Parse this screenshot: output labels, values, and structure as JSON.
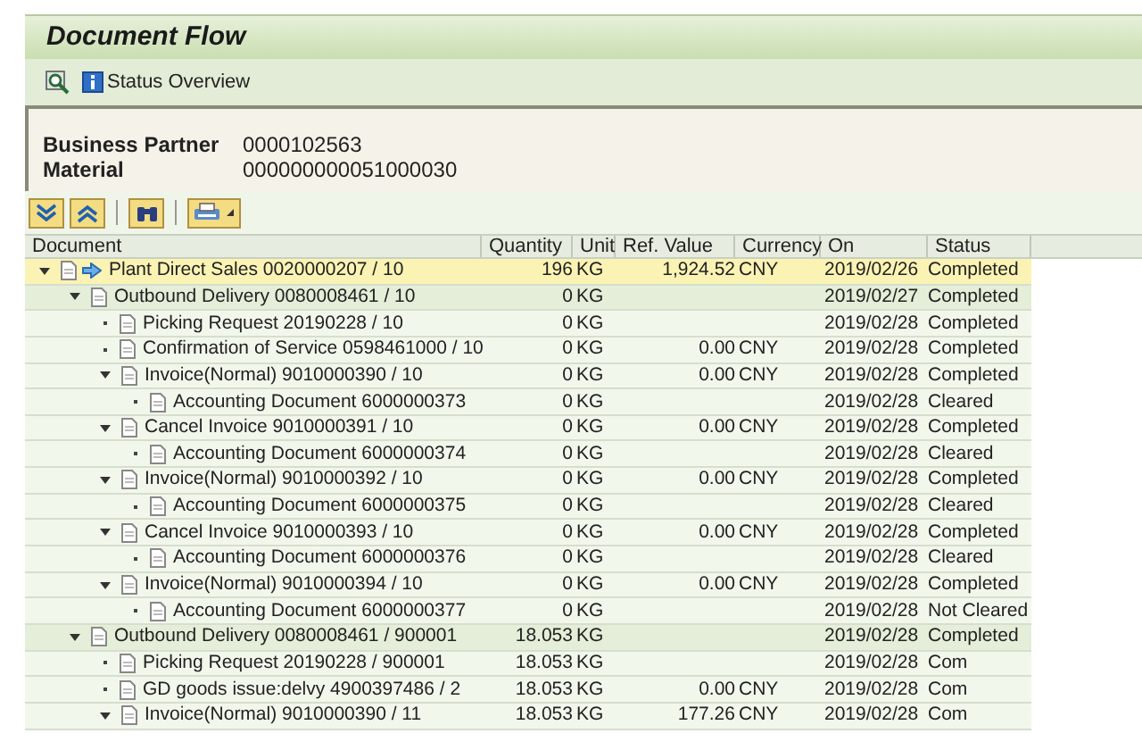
{
  "window": {
    "title": "Document Flow"
  },
  "toolbar": {
    "items": [
      {
        "kind": "icon"
      },
      {
        "kind": "info",
        "label": "Status Overview"
      }
    ]
  },
  "header": {
    "fields": [
      {
        "label": "Business Partner",
        "value": "0000102563"
      },
      {
        "label": "Material",
        "value": "000000000051000030"
      }
    ]
  },
  "table": {
    "columns": [
      "Document",
      "Quantity",
      "Unit",
      "Ref. Value",
      "Currency",
      "On",
      "Status"
    ],
    "rows": [
      {
        "document": "Plant Direct Sales 0020000207 / 10",
        "quantity": "196",
        "unit": "KG",
        "ref_value": "1,924.52",
        "currency": "CNY",
        "on": "2019/02/26",
        "status": "Completed",
        "expanded": true,
        "current": true,
        "children": [
          {
            "document": "Outbound Delivery 0080008461 / 10",
            "quantity": "0",
            "unit": "KG",
            "on": "2019/02/27",
            "status": "Completed",
            "expanded": true,
            "current": false,
            "children": [
              {
                "document": "Picking Request 20190228 / 10",
                "quantity": "0",
                "unit": "KG",
                "on": "2019/02/28",
                "status": "Completed",
                "expanded": false,
                "current": false
              },
              {
                "document": "Confirmation of Service 0598461000 / 10",
                "quantity": "0",
                "unit": "KG",
                "ref_value": "0.00",
                "currency": "CNY",
                "on": "2019/02/28",
                "status": "Completed",
                "expanded": false,
                "current": false
              },
              {
                "document": "Invoice(Normal) 9010000390 / 10",
                "quantity": "0",
                "unit": "KG",
                "ref_value": "0.00",
                "currency": "CNY",
                "on": "2019/02/28",
                "status": "Completed",
                "expanded": true,
                "current": false,
                "children": [
                  {
                    "document": "Accounting Document 6000000373",
                    "quantity": "0",
                    "unit": "KG",
                    "on": "2019/02/28",
                    "status": "Cleared",
                    "expanded": false,
                    "current": false
                  }
                ]
              },
              {
                "document": "Cancel Invoice 9010000391 / 10",
                "quantity": "0",
                "unit": "KG",
                "ref_value": "0.00",
                "currency": "CNY",
                "on": "2019/02/28",
                "status": "Completed",
                "expanded": true,
                "current": false,
                "children": [
                  {
                    "document": "Accounting Document 6000000374",
                    "quantity": "0",
                    "unit": "KG",
                    "on": "2019/02/28",
                    "status": "Cleared",
                    "expanded": false,
                    "current": false
                  }
                ]
              },
              {
                "document": "Invoice(Normal) 9010000392 / 10",
                "quantity": "0",
                "unit": "KG",
                "ref_value": "0.00",
                "currency": "CNY",
                "on": "2019/02/28",
                "status": "Completed",
                "expanded": true,
                "current": false,
                "children": [
                  {
                    "document": "Accounting Document 6000000375",
                    "quantity": "0",
                    "unit": "KG",
                    "on": "2019/02/28",
                    "status": "Cleared",
                    "expanded": false,
                    "current": false
                  }
                ]
              },
              {
                "document": "Cancel Invoice 9010000393 / 10",
                "quantity": "0",
                "unit": "KG",
                "ref_value": "0.00",
                "currency": "CNY",
                "on": "2019/02/28",
                "status": "Completed",
                "expanded": true,
                "current": false,
                "children": [
                  {
                    "document": "Accounting Document 6000000376",
                    "quantity": "0",
                    "unit": "KG",
                    "on": "2019/02/28",
                    "status": "Cleared",
                    "expanded": false,
                    "current": false
                  }
                ]
              },
              {
                "document": "Invoice(Normal) 9010000394 / 10",
                "quantity": "0",
                "unit": "KG",
                "ref_value": "0.00",
                "currency": "CNY",
                "on": "2019/02/28",
                "status": "Completed",
                "expanded": true,
                "current": false,
                "children": [
                  {
                    "document": "Accounting Document 6000000377",
                    "quantity": "0",
                    "unit": "KG",
                    "on": "2019/02/28",
                    "status": "Not Cleared",
                    "expanded": false,
                    "current": false
                  }
                ]
              }
            ]
          },
          {
            "document": "Outbound Delivery 0080008461 / 900001",
            "quantity": "18.053",
            "unit": "KG",
            "on": "2019/02/28",
            "status": "Completed",
            "expanded": true,
            "current": false,
            "children": [
              {
                "document": "Picking Request 20190228 / 900001",
                "quantity": "18.053",
                "unit": "KG",
                "on": "2019/02/28",
                "status": "Com",
                "expanded": false,
                "current": false
              },
              {
                "document": "GD goods issue:delvy 4900397486 / 2",
                "quantity": "18.053",
                "unit": "KG",
                "ref_value": "0.00",
                "currency": "CNY",
                "on": "2019/02/28",
                "status": "Com",
                "expanded": false,
                "current": false
              },
              {
                "document": "Invoice(Normal) 9010000390 / 11",
                "quantity": "18.053",
                "unit": "KG",
                "ref_value": "177.26",
                "currency": "CNY",
                "on": "2019/02/28",
                "status": "Com",
                "expanded": true,
                "current": false
              }
            ]
          }
        ]
      }
    ]
  }
}
